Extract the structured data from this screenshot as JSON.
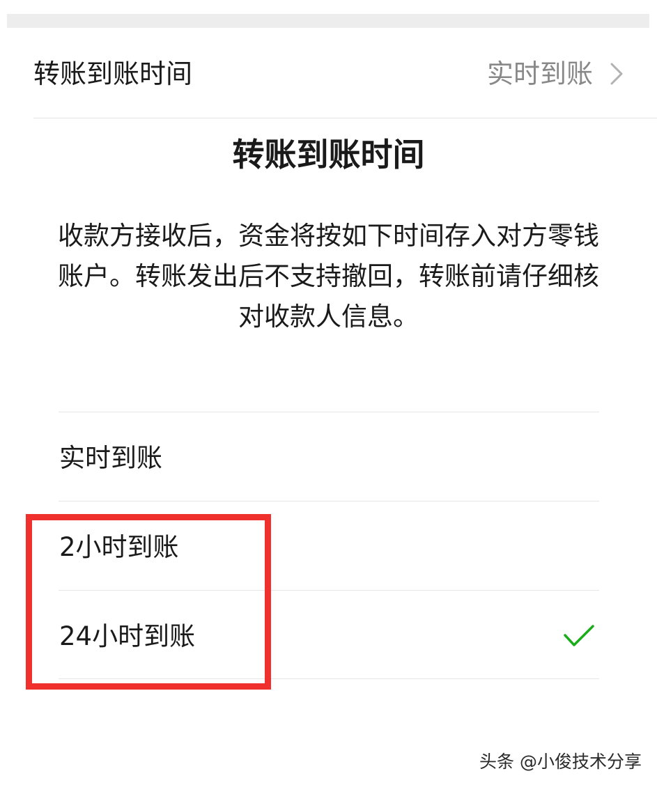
{
  "setting_row": {
    "label": "转账到账时间",
    "value": "实时到账",
    "chevron_icon": "chevron-right-icon"
  },
  "dialog": {
    "title": "转账到账时间",
    "description": "收款方接收后，资金将按如下时间存入对方零钱账户。转账发出后不支持撤回，转账前请仔细核对收款人信息。",
    "options": [
      {
        "label": "实时到账",
        "selected": false
      },
      {
        "label": "2小时到账",
        "selected": false
      },
      {
        "label": "24小时到账",
        "selected": true
      }
    ],
    "selected_icon": "checkmark-icon"
  },
  "annotation": {
    "highlight_color": "#f0302c"
  },
  "colors": {
    "check": "#1aad19",
    "muted_text": "#888888",
    "strip": "#ededed"
  },
  "watermark": "头条 @小俊技术分享"
}
